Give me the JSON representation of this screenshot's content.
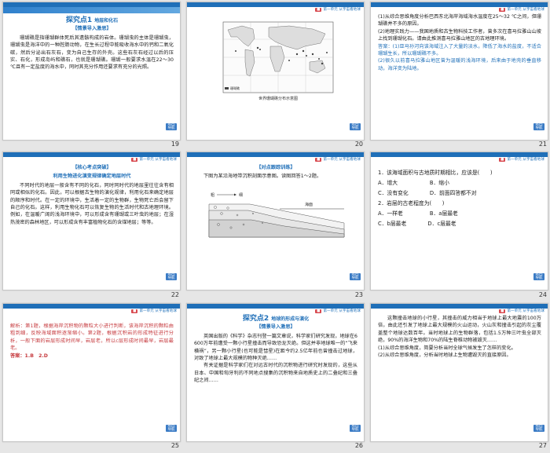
{
  "header_label": "第一单元 从宇宙看地球",
  "nav_label": "返回\n导航",
  "slides": [
    {
      "number": "19",
      "strip": "课堂探究·核心突破",
      "title": "探究点1",
      "title_small": "地层和化石",
      "sub": "【情景导入激思】",
      "text": "珊瑚礁是指珊瑚群体死后其遗骸构成的岩体。珊瑚虫的主体是珊瑚虫，珊瑚虫是海洋中的一种腔肠动物，在生长过程中能吸收海水中的钙和二氧化碳，然后分泌出石灰石，变为自己生存的外壳。这些石灰石经过以后的压实、石化，形成岛屿和礁石，也就是珊瑚礁。珊瑚一般要求水温在22～30 ℃且有一定盐度的海水中，同时其充分作用还要求有充分的光照。"
    },
    {
      "number": "20",
      "map_caption": "世界珊瑚礁分布示意图",
      "legend": "珊瑚礁"
    },
    {
      "number": "21",
      "lines": [
        "(1)从综合思维角度分析巴西东北海岸海域海水温度在25～32 ℃之间，但珊瑚礁并不多的原因。",
        "(2)地理实践力——我国地质和古生物科技工作者，曾多次在喜马拉雅山山坡上找到珊瑚化石。请由此推测喜马拉雅山地区的古地理环境。",
        "答案：(1)亚马孙河向该海域注入了大量的淡水，降低了海水的盐度，不适合珊瑚生长，所以珊瑚礁不多。",
        "(2)很久以前喜马拉雅山地区曾为温暖的浅海环境，后来由于地壳的垂直移动，海洋变为陆地。"
      ]
    },
    {
      "number": "22",
      "sub": "【核心考点突破】",
      "sub2": "利用生物进化演变规律确定地层时代",
      "text": "不同时代的地层一般含有不同的化石，同时同时代的地层里往往含有相同或相似的化石。因此，可以根据古生物的演化规律，利用化石来确定地层的顺序和时代。在一定的环境中，生活着一定的生物群，生物死亡后会留下自己的化石。这样，利用生物化石可以恢复生物的生活时代和古地理环境。例如，在温暖广阔的浅海环境中，可以形成含有珊瑚或三叶虫的地层；在湿热茂密的森林地区，可以形成含有丰富植物化石的含煤地层；等等。"
    },
    {
      "number": "23",
      "sub": "【对点跟踪训练】",
      "text": "下图为某沿海地带沉积剖面示意图。读图回答1～2题。",
      "label_coarse": "粗",
      "label_fine": "细",
      "label_sea": "海面"
    },
    {
      "number": "24",
      "lines": [
        "1．该海域面积与古地质时期相比，应该是(　　)",
        "A．增大　　　　　　B．缩小",
        "C．没有变化　　　　D．前面四答都不对",
        "2．岩层的古老程度为(　　)",
        "A．一样老　　　　　B．a层最老",
        "C．b层最老　　　　D．c层最老"
      ]
    },
    {
      "number": "25",
      "text": "解析：第1题，根据海岸沉积物的颗粒大小进行判断，该海岸沉积的颗粒由粗到细，反映海域面积逐渐缩小。第2题，根据沉积岩的形成特征进行分析，一般下面的岩层形成时间早，岩层老，所以c层形成时间最早，岩层最老。",
      "answer": "答案：1.B　2.D"
    },
    {
      "number": "26",
      "title": "探究点2",
      "title_small": "地球的形成与演化",
      "sub": "【情景导入激思】",
      "text": "英国出版的《科学》杂志刊登一篇文章说，科学家们研究发现，地球在6 600万年前遭受一颗小行星撞击而导致恐龙灭绝。但这并非地球唯一的“飞来横祸”，另一颗小行星(也可能是彗星)在距今约2.5亿年前也曾撞击过地球，对致了地球上最大规模的物种灭绝……",
      "text2": "有关证据是科学家们在对远古时代的沉积物进行研究时发现的，这些从日本、中国和匈牙利的不同地点搜集的沉积物来自地质史上的二叠纪和三叠纪之间……"
    },
    {
      "number": "27",
      "text": "这颗撞击地球的小行星，其撞击的威力相当于地球上最大地震的100万倍，由此还引发了地球上最大规模的火山运动，火山灰和撞击引起的灰尘覆盖整个地球达数百年。当时地球上的生物群落，包括1.5万种三叶虫全部灭绝，90%的海洋生物和70%的陆生脊椎动物被毁灭……",
      "q1": "(1)从综合思维角度，简要分析当时全球气候发生了怎样的变化。",
      "q2": "(2)从综合思维角度，分析当时地球上生物遭毁灭的直接原因。"
    }
  ]
}
